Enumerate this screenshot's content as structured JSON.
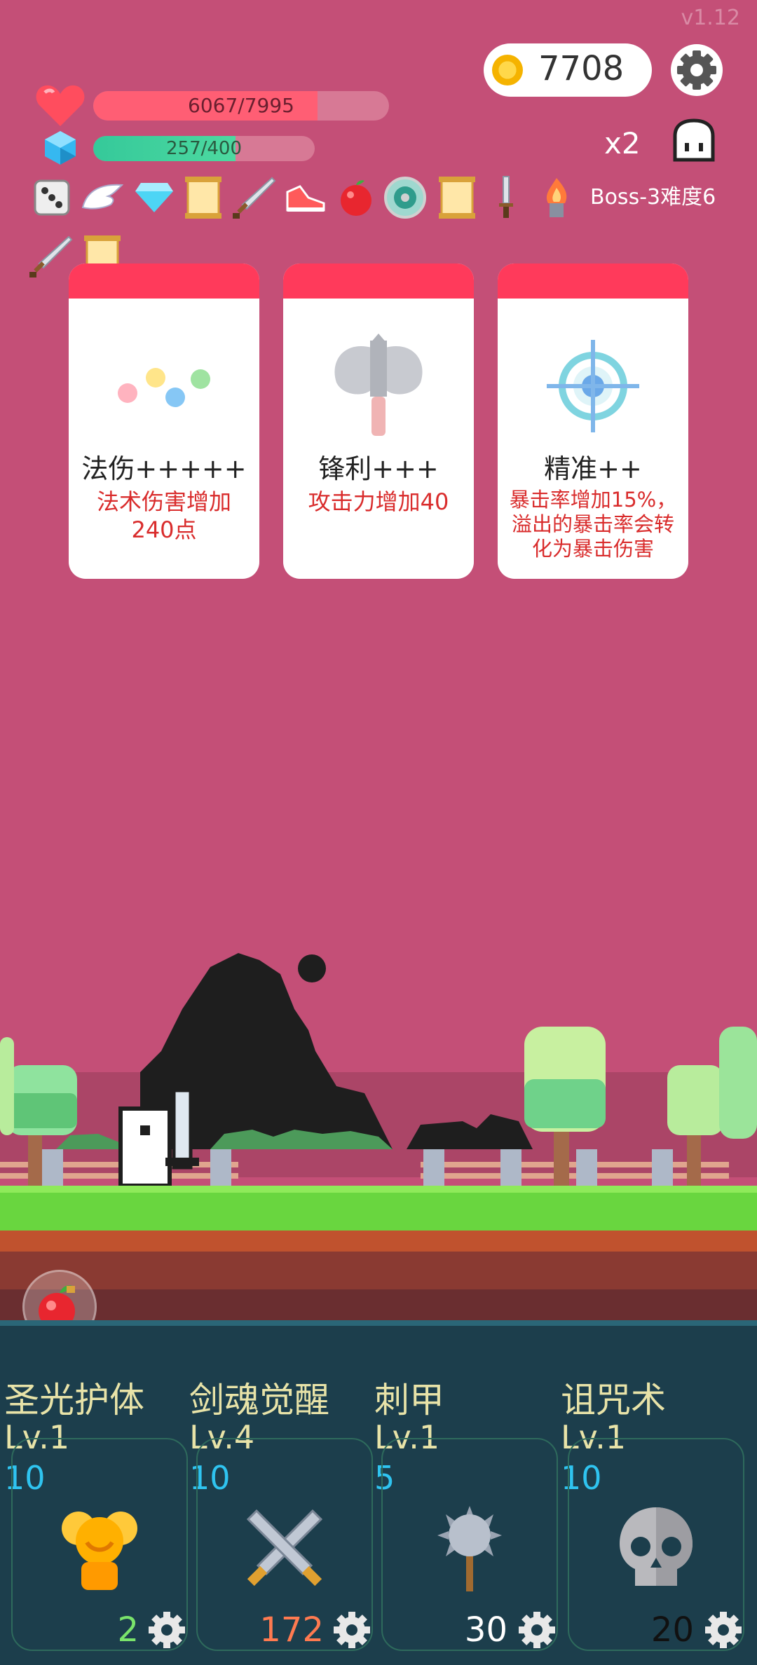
{
  "version": "v1.12",
  "coins": "7708",
  "hp": {
    "text": "6067/7995",
    "current": 6067,
    "max": 7995
  },
  "mp": {
    "text": "257/400",
    "current": 257,
    "max": 400
  },
  "speed": "x2",
  "boss_label": "Boss-3难度6",
  "items": [
    "dice-icon",
    "wing-icon",
    "diamond-icon",
    "scroll-icon",
    "sword-icon",
    "shoe-icon",
    "apple-icon",
    "shield-icon",
    "scroll-icon",
    "dagger-icon",
    "flame-icon",
    "sword-icon",
    "scroll-icon"
  ],
  "cards": [
    {
      "title": "法伤+++++",
      "desc": "法术伤害增加240点",
      "icon": "magic-dots-icon"
    },
    {
      "title": "锋利+++",
      "desc": "攻击力增加40",
      "icon": "axe-icon"
    },
    {
      "title": "精准++",
      "desc": "暴击率增加15%，溢出的暴击率会转化为暴击伤害",
      "icon": "crosshair-icon"
    }
  ],
  "skills": [
    {
      "name": "圣光护体",
      "level": "Lv.1",
      "cost": "10",
      "count": "2",
      "icon": "golden-shield-icon"
    },
    {
      "name": "剑魂觉醒",
      "level": "Lv.4",
      "cost": "10",
      "count": "172",
      "icon": "crossed-swords-icon"
    },
    {
      "name": "刺甲",
      "level": "Lv.1",
      "cost": "5",
      "count": "30",
      "icon": "spiked-mace-icon"
    },
    {
      "name": "诅咒术",
      "level": "Lv.1",
      "cost": "10",
      "count": "20",
      "icon": "skull-icon"
    }
  ],
  "colors": {
    "background": "#c44f77",
    "card_header": "#ff3a5b",
    "hp": "#ff5e74",
    "mp": "#35c99a",
    "panel": "#1c3e4c",
    "cost": "#2fc4f0"
  }
}
